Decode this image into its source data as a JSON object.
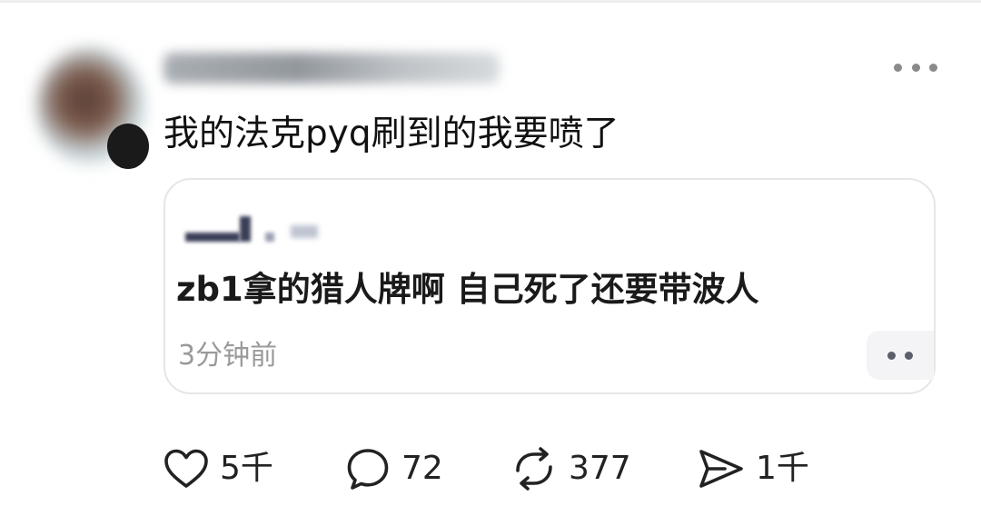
{
  "post": {
    "text": "我的法克pyq刷到的我要喷了"
  },
  "quote": {
    "text": "zb1拿的猎人牌啊 自己死了还要带波人",
    "time": "3分钟前"
  },
  "actions": {
    "likes": "5千",
    "comments": "72",
    "reposts": "377",
    "shares": "1千"
  },
  "icons": {
    "like": "heart-icon",
    "comment": "comment-bubble-icon",
    "repost": "repost-arrows-icon",
    "share": "send-arrow-icon",
    "more": "more-dots-icon"
  },
  "colors": {
    "text": "#111111",
    "muted": "#9a9a9a",
    "border": "#e6e6e6"
  }
}
